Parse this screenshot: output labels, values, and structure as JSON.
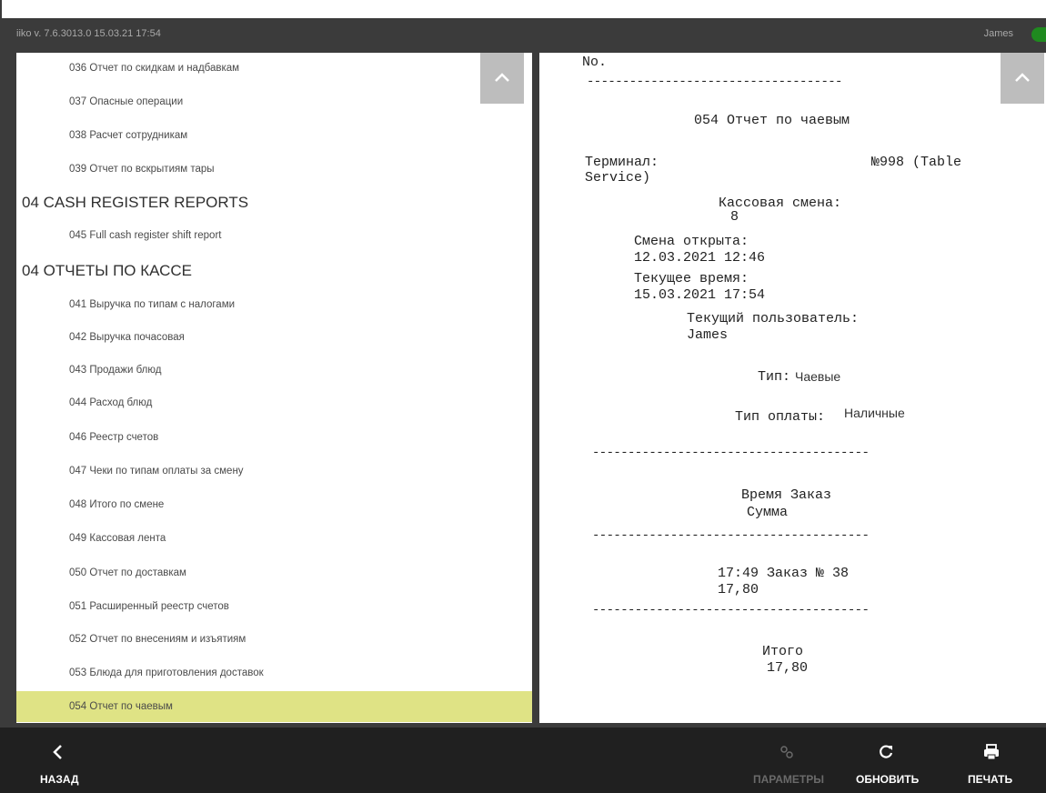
{
  "header": {
    "version": "iiko  v. 7.6.3013.0    15.03.21  17:54",
    "user": "James"
  },
  "list": [
    {
      "type": "report",
      "label": "036 Отчет по скидкам и надбавкам"
    },
    {
      "type": "report",
      "label": "037 Опасные операции"
    },
    {
      "type": "report",
      "label": "038 Расчет сотрудникам"
    },
    {
      "type": "report",
      "label": "039 Отчет по вскрытиям тары"
    },
    {
      "type": "section",
      "label": "04 CASH REGISTER REPORTS"
    },
    {
      "type": "report",
      "label": "045 Full cash register shift report"
    },
    {
      "type": "section",
      "label": "04 ОТЧЕТЫ ПО КАССЕ"
    },
    {
      "type": "report",
      "label": "041 Выручка по типам с налогами"
    },
    {
      "type": "report",
      "label": "042 Выручка почасовая"
    },
    {
      "type": "report",
      "label": "043 Продажи блюд"
    },
    {
      "type": "report",
      "label": "044 Расход блюд"
    },
    {
      "type": "report",
      "label": "046 Реестр счетов"
    },
    {
      "type": "report",
      "label": "047 Чеки по типам оплаты за смену"
    },
    {
      "type": "report",
      "label": "048 Итого по смене"
    },
    {
      "type": "report",
      "label": "049 Кассовая лента"
    },
    {
      "type": "report",
      "label": "050 Отчет по доставкам"
    },
    {
      "type": "report",
      "label": "051 Расширенный реестр счетов"
    },
    {
      "type": "report",
      "label": "052 Отчет по внесениям и изъятиям"
    },
    {
      "type": "report",
      "label": "053 Блюда для приготовления доставок"
    },
    {
      "type": "report",
      "label": "054 Отчет по чаевым",
      "selected": true
    }
  ],
  "receipt": {
    "no": "No.",
    "sep_short": "------------------------------------",
    "sep_long": "---------------------------------------",
    "title": "054 Отчет по чаевым",
    "terminal_label": "Терминал:",
    "terminal_value": "№998 (Table",
    "terminal_value2": "Service)",
    "shift_label": "Кассовая смена:",
    "shift_value": "8",
    "opened_label": "Смена открыта:",
    "opened_value": "12.03.2021 12:46",
    "current_time_label": "Текущее время:",
    "current_time_value": "15.03.2021 17:54",
    "current_user_label": "Текущий пользователь:",
    "current_user_value": "James",
    "type_label": "Тип:",
    "type_value": "Чаевые",
    "pay_type_label": "Тип оплаты:",
    "pay_type_value": "Наличные",
    "col_header1": "Время Заказ",
    "col_header2": "Сумма",
    "row_line1": "17:49 Заказ № 38",
    "row_line2": "17,80",
    "total_label": "Итого",
    "total_value": "17,80"
  },
  "footer": {
    "back": "НАЗАД",
    "params": "ПАРАМЕТРЫ",
    "refresh": "ОБНОВИТЬ",
    "print": "ПЕЧАТЬ"
  },
  "icons": {
    "back": "chevron-left-icon",
    "params": "gears-icon",
    "refresh": "refresh-icon",
    "print": "printer-icon",
    "scroll": "chevron-up-icon"
  },
  "colors": {
    "selected_row": "#dfe385",
    "status_online": "#1f8a1f",
    "dark_bg": "#3b3b3b",
    "footer_bg": "#202020"
  }
}
